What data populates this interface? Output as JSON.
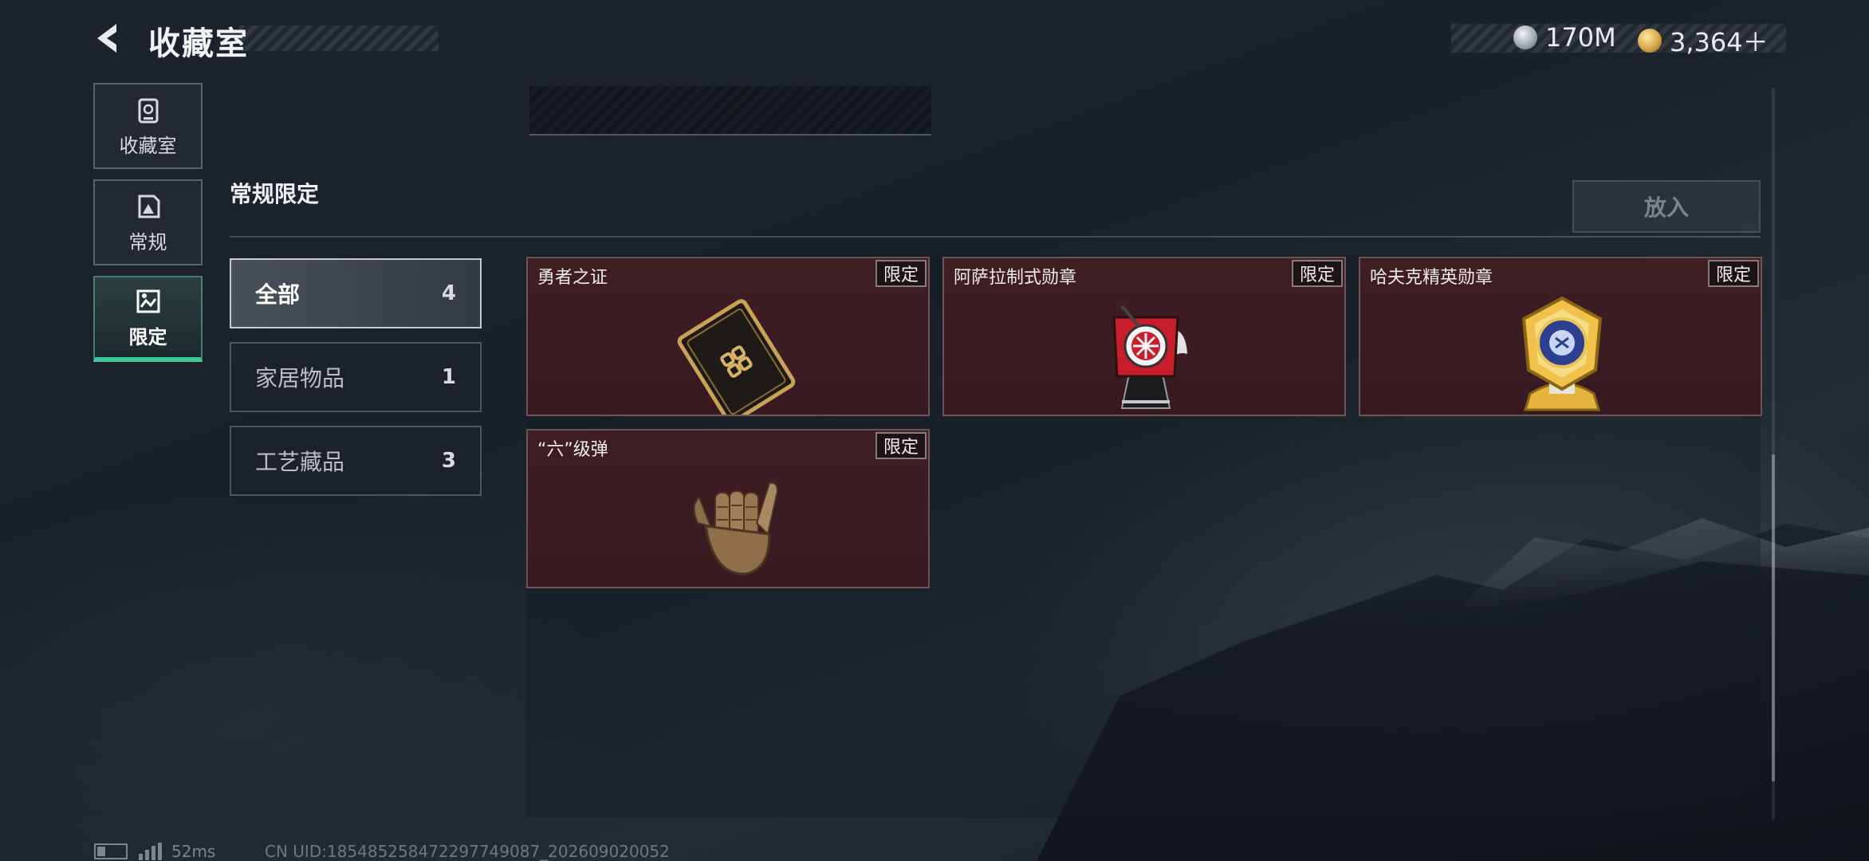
{
  "header": {
    "title": "收藏室",
    "currency": [
      {
        "icon": "silver-coin-icon",
        "value": "170M"
      },
      {
        "icon": "gold-coin-icon",
        "value": "3,364＋"
      }
    ]
  },
  "nav": [
    {
      "label": "收藏室",
      "icon": "collection-room-icon",
      "active": false
    },
    {
      "label": "常规",
      "icon": "regular-icon",
      "active": false
    },
    {
      "label": "限定",
      "icon": "limited-icon",
      "active": true
    }
  ],
  "section": {
    "title": "常规限定",
    "put_button": "放入"
  },
  "filters": [
    {
      "label": "全部",
      "count": "4",
      "active": true
    },
    {
      "label": "家居物品",
      "count": "1",
      "active": false
    },
    {
      "label": "工艺藏品",
      "count": "3",
      "active": false
    }
  ],
  "items": [
    {
      "name": "勇者之证",
      "badge": "限定",
      "art": "brave-card-icon"
    },
    {
      "name": "阿萨拉制式勋章",
      "badge": "限定",
      "art": "asara-medal-icon"
    },
    {
      "name": "哈夫克精英勋章",
      "badge": "限定",
      "art": "haavk-elite-medal-icon"
    },
    {
      "name": "“六”级弹",
      "badge": "限定",
      "art": "six-hand-sign-icon"
    }
  ],
  "status": {
    "ping": "52ms",
    "uid": "CN UID:18548525847229774908​7_202609020052"
  }
}
